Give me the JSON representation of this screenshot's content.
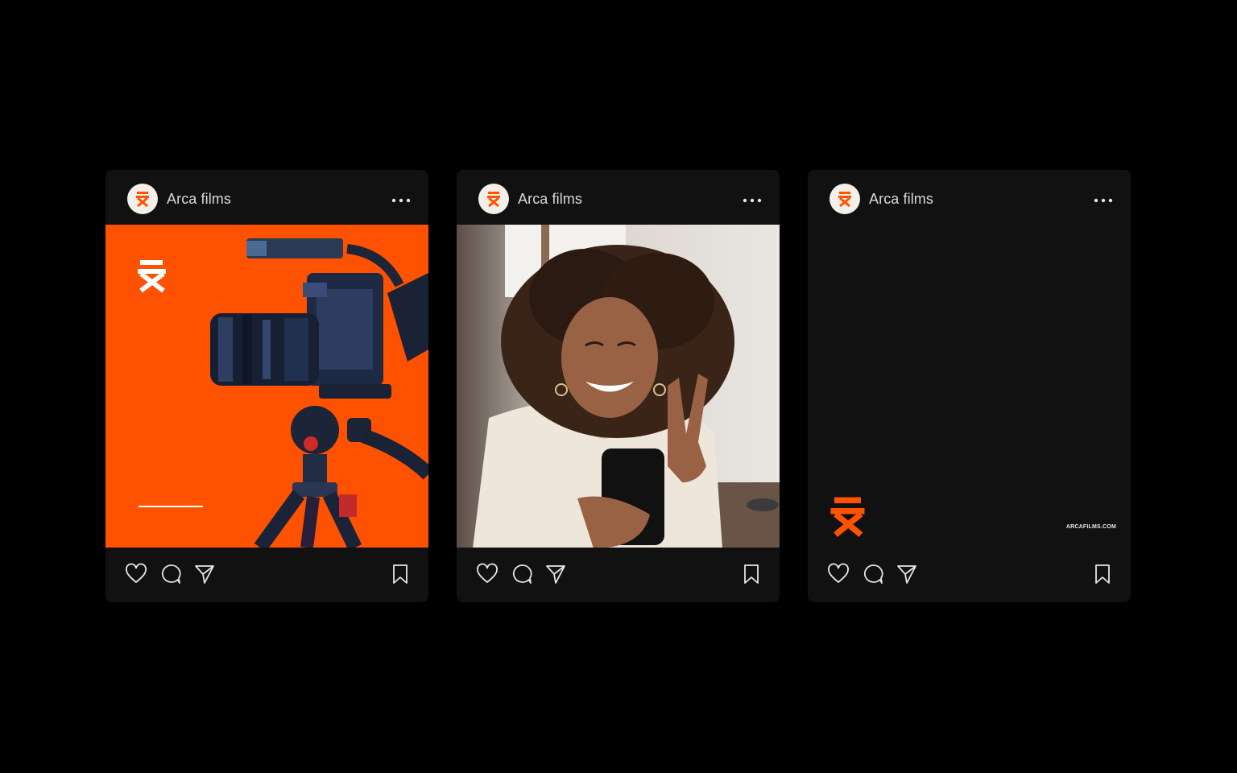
{
  "brand": {
    "accent": "#ff5200",
    "logo_icon": "director-chair-icon"
  },
  "posts": [
    {
      "account_name": "Arca films",
      "media": "camera-on-tripod-photo",
      "background": "#ff5200"
    },
    {
      "account_name": "Arca films",
      "media": "woman-taking-selfie-photo"
    },
    {
      "account_name": "Arca films",
      "media": "dark-brand-graphic",
      "website": "ARCAFILMS.COM"
    }
  ],
  "icons": {
    "more": "more-dots-icon",
    "like": "heart-icon",
    "comment": "comment-bubble-icon",
    "share": "paper-plane-icon",
    "save": "bookmark-icon"
  }
}
